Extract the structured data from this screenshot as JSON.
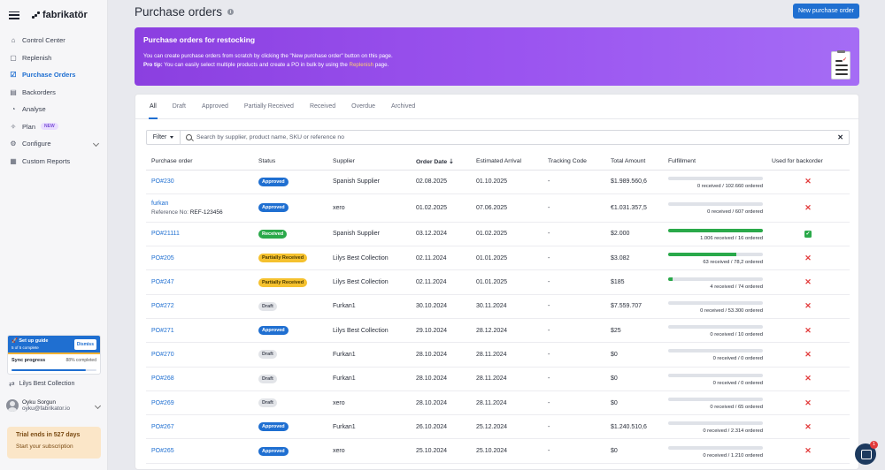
{
  "app": {
    "name": "fabrikatör"
  },
  "sidebar": {
    "items": [
      {
        "label": "Control Center"
      },
      {
        "label": "Replenish"
      },
      {
        "label": "Purchase Orders"
      },
      {
        "label": "Backorders"
      },
      {
        "label": "Analyse"
      },
      {
        "label": "Plan",
        "badge": "NEW"
      },
      {
        "label": "Configure"
      },
      {
        "label": "Custom Reports"
      }
    ],
    "setup": {
      "title": "Set up guide",
      "progress": "5 of 5 complete",
      "dismiss": "Dismiss",
      "sync_label": "Sync progress",
      "sync_value": "88% completed",
      "sync_fraction": 0.88
    },
    "store": "Lilys Best Collection",
    "user": {
      "name": "Oyku Sorgun",
      "email": "oyku@fabrikator.io"
    },
    "trial": {
      "title": "Trial ends in 527 days",
      "cta": "Start your subscription"
    }
  },
  "header": {
    "title": "Purchase orders",
    "new_button": "New purchase order"
  },
  "banner": {
    "title": "Purchase orders for restocking",
    "line1": "You can create purchase orders from scratch by clicking the \"New purchase order\" button on this page.",
    "line2_prefix": "Pro tip:",
    "line2_text": " You can easily select multiple products and create a PO in bulk by using the ",
    "line2_link": "Replenish",
    "line2_suffix": " page."
  },
  "tabs": [
    "All",
    "Draft",
    "Approved",
    "Partially Received",
    "Received",
    "Overdue",
    "Archived"
  ],
  "filter": {
    "label": "Filter",
    "placeholder": "Search by supplier, product name, SKU or reference no"
  },
  "table": {
    "headers": [
      "Purchase order",
      "Status",
      "Supplier",
      "Order Date",
      "Estimated Arrival",
      "Tracking Code",
      "Total Amount",
      "Fulfillment",
      "Used for backorder"
    ],
    "rows": [
      {
        "po": "PO#230",
        "status": "Approved",
        "supplier": "Spanish Supplier",
        "order_date": "02.08.2025",
        "arrival": "01.10.2025",
        "tracking": "-",
        "amount": "$1.989.560,6",
        "fulfillment": "0 received / 102.660 ordered",
        "fill": 0,
        "backorder": "x"
      },
      {
        "po": "furkan",
        "ref_label": "Reference No:",
        "ref": "REF-123456",
        "status": "Approved",
        "supplier": "xero",
        "order_date": "01.02.2025",
        "arrival": "07.06.2025",
        "tracking": "-",
        "amount": "€1.031.357,5",
        "fulfillment": "0 received / 607 ordered",
        "fill": 0,
        "backorder": "x"
      },
      {
        "po": "PO#21111",
        "status": "Received",
        "supplier": "Spanish Supplier",
        "order_date": "03.12.2024",
        "arrival": "01.02.2025",
        "tracking": "-",
        "amount": "$2.000",
        "fulfillment": "1.006 received / 16 ordered",
        "fill": 1,
        "backorder": "check"
      },
      {
        "po": "PO#205",
        "status": "Partially Received",
        "supplier": "Lilys Best Collection",
        "order_date": "02.11.2024",
        "arrival": "01.01.2025",
        "tracking": "-",
        "amount": "$3.082",
        "fulfillment": "63 received / 78,2 ordered",
        "fill": 0.72,
        "backorder": "x"
      },
      {
        "po": "PO#247",
        "status": "Partially Received",
        "supplier": "Lilys Best Collection",
        "order_date": "02.11.2024",
        "arrival": "01.01.2025",
        "tracking": "-",
        "amount": "$185",
        "fulfillment": "4 received / 74 ordered",
        "fill": 0.05,
        "backorder": "x"
      },
      {
        "po": "PO#272",
        "status": "Draft",
        "supplier": "Furkan1",
        "order_date": "30.10.2024",
        "arrival": "30.11.2024",
        "tracking": "-",
        "amount": "$7.559.707",
        "fulfillment": "0 received / 53.300 ordered",
        "fill": 0,
        "backorder": "x"
      },
      {
        "po": "PO#271",
        "status": "Approved",
        "supplier": "Lilys Best Collection",
        "order_date": "29.10.2024",
        "arrival": "28.12.2024",
        "tracking": "-",
        "amount": "$25",
        "fulfillment": "0 received / 10 ordered",
        "fill": 0,
        "backorder": "x"
      },
      {
        "po": "PO#270",
        "status": "Draft",
        "supplier": "Furkan1",
        "order_date": "28.10.2024",
        "arrival": "28.11.2024",
        "tracking": "-",
        "amount": "$0",
        "fulfillment": "0 received / 0 ordered",
        "fill": 0,
        "backorder": "x"
      },
      {
        "po": "PO#268",
        "status": "Draft",
        "supplier": "Furkan1",
        "order_date": "28.10.2024",
        "arrival": "28.11.2024",
        "tracking": "-",
        "amount": "$0",
        "fulfillment": "0 received / 0 ordered",
        "fill": 0,
        "backorder": "x"
      },
      {
        "po": "PO#269",
        "status": "Draft",
        "supplier": "xero",
        "order_date": "28.10.2024",
        "arrival": "28.11.2024",
        "tracking": "-",
        "amount": "$0",
        "fulfillment": "0 received / 65 ordered",
        "fill": 0,
        "backorder": "x"
      },
      {
        "po": "PO#267",
        "status": "Approved",
        "supplier": "Furkan1",
        "order_date": "26.10.2024",
        "arrival": "25.12.2024",
        "tracking": "-",
        "amount": "$1.240.510,6",
        "fulfillment": "0 received / 2.314 ordered",
        "fill": 0,
        "backorder": "x"
      },
      {
        "po": "PO#265",
        "status": "Approved",
        "supplier": "xero",
        "order_date": "25.10.2024",
        "arrival": "25.10.2024",
        "tracking": "-",
        "amount": "$0",
        "fulfillment": "0 received / 1.210 ordered",
        "fill": 0,
        "backorder": "x"
      }
    ]
  },
  "chat": {
    "badge": "1"
  },
  "colors": {
    "accent": "#1f6fd1",
    "banner": "#9b55f0",
    "received": "#2aa94a",
    "partial": "#f5c12e",
    "error": "#e23b3b"
  }
}
